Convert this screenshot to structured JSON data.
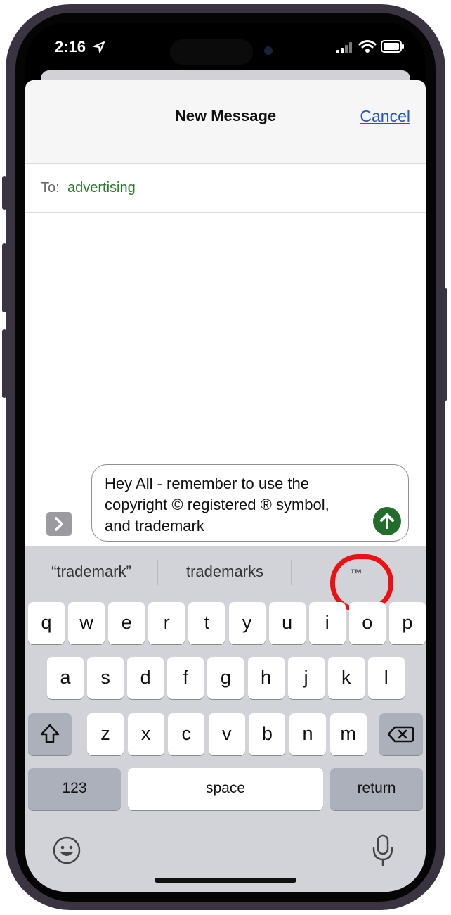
{
  "status": {
    "time": "2:16"
  },
  "header": {
    "title": "New Message",
    "cancel_label": "Cancel"
  },
  "recipient": {
    "label": "To:",
    "value": "advertising"
  },
  "compose": {
    "line1": "Hey All - remember to use the",
    "line2": "copyright © registered ® symbol,",
    "line3": "and trademark"
  },
  "suggestions": [
    "“trademark”",
    "trademarks",
    "™"
  ],
  "keyboard": {
    "row1": [
      "q",
      "w",
      "e",
      "r",
      "t",
      "y",
      "u",
      "i",
      "o",
      "p"
    ],
    "row2": [
      "a",
      "s",
      "d",
      "f",
      "g",
      "h",
      "j",
      "k",
      "l"
    ],
    "row3": [
      "z",
      "x",
      "c",
      "v",
      "b",
      "n",
      "m"
    ],
    "numbers_label": "123",
    "space_label": "space",
    "return_label": "return"
  },
  "icons": {
    "location": "location-arrow-icon",
    "signal": "cellular-signal-icon",
    "wifi": "wifi-icon",
    "battery": "battery-icon",
    "expand": "chevron-right-icon",
    "send": "send-arrow-icon",
    "shift": "shift-icon",
    "delete": "backspace-icon",
    "emoji": "emoji-icon",
    "mic": "microphone-icon"
  },
  "colors": {
    "accent_link": "#2155c9",
    "recipient": "#2d7a30",
    "send": "#226d2b",
    "highlight_circle": "#ee0f14"
  }
}
